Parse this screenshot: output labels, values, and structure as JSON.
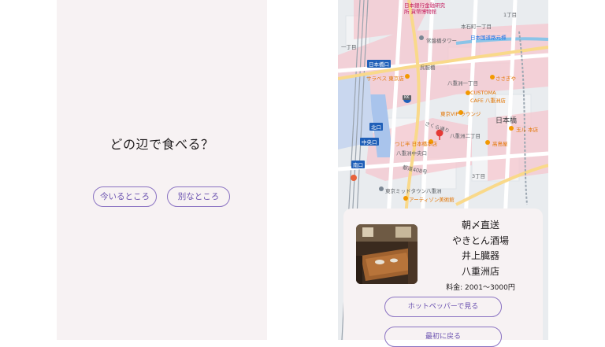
{
  "left": {
    "question": "どの辺で食べる？",
    "buttons": {
      "here": "今いるところ",
      "other": "別なところ"
    }
  },
  "map": {
    "labels": {
      "bank_museum": "日本銀行金融研究",
      "currency_museum": "所 貨幣博物館",
      "chome1_top": "1丁目",
      "honishi": "本石町一丁目",
      "tokiwa": "常盤橋タワー",
      "nihonbashi_daimaru": "日本国道路元標",
      "chome_left": "一丁目",
      "nihonbashi_exit": "日本橋口",
      "saraves": "サラベス 東京店",
      "kosho": "呉服橋",
      "yaesu1": "八重洲一丁目",
      "sasagiya": "ささぎや",
      "customa": "CUSTOMA",
      "cafe": "CAFE 八重洲店",
      "vip": "東京VIP ラウンジ",
      "nihonbashi": "日本橋",
      "kita": "北口",
      "sakura": "さくら通り",
      "yaesu2": "八重洲二丁目",
      "tamahide": "玉ル 本店",
      "chuo": "中央口",
      "tsujihan": "つじ半 日本橋本店",
      "yaesu_chuo": "八重洲中央口",
      "takashimaya": "高島屋",
      "minami": "南口",
      "route408": "都道408号",
      "chome3": "3丁目",
      "midtown": "東京ミッドタウン八重洲",
      "artizon": "アーティゾン美術館",
      "kk": "KK",
      "exit_sign": "⊕"
    }
  },
  "card": {
    "name_lines": [
      "朝〆直送",
      "やきとん酒場",
      "井上臓器",
      "八重洲店"
    ],
    "price": "料金: 2001〜3000円",
    "hotpepper_button": "ホットペッパーで見る",
    "first_button": "最初に戻る"
  },
  "colors": {
    "screen_bg": "#f7f2f3",
    "accent_border": "#8a72c2",
    "accent_text": "#6b52b0",
    "map_bg": "#e8ebef"
  }
}
